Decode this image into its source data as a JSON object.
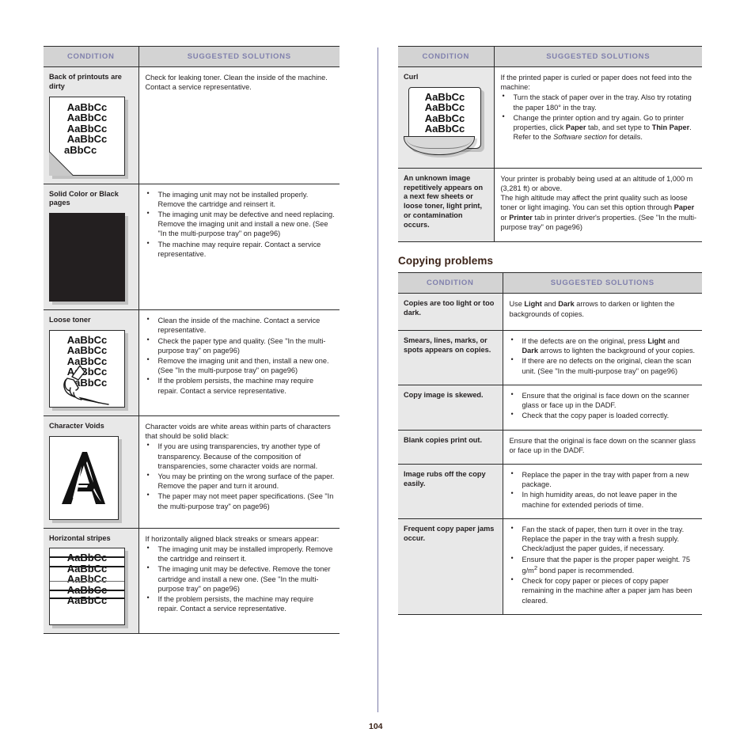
{
  "page": {
    "number": "104",
    "accent_header_bg": "#d3d3d3",
    "accent_header_text": "#8080ad",
    "rule_color": "#7b7ba8",
    "heading_color": "#3b2318"
  },
  "columns": {
    "left": {
      "table": {
        "headers": [
          "CONDITION",
          "SUGGESTED SOLUTIONS"
        ],
        "rows": [
          {
            "condition": "Back of printouts are dirty",
            "sample": "dirty-page-sample",
            "sample_lines": [
              "AaBbCc",
              "AaBbCc",
              "AaBbCc",
              "AaBbCc",
              "aBbCc"
            ],
            "lead": "Check for leaking toner. Clean the inside of the machine. Contact a service representative.",
            "bullets": []
          },
          {
            "condition": "Solid Color or Black pages",
            "sample": "solid-black-page-sample",
            "sample_lines": [],
            "lead": "",
            "bullets": [
              "The imaging unit may not be installed properly. Remove the cartridge and reinsert it.",
              "The imaging unit may be defective and need replacing. Remove the imaging unit and install a new one. (See \"In the multi-purpose tray\" on page96)",
              "The machine may require repair. Contact a service representative."
            ]
          },
          {
            "condition": "Loose toner",
            "sample": "loose-toner-page-sample",
            "sample_lines": [
              "AaBbCc",
              "AaBbCc",
              "AaBbCc",
              "AaBbCc",
              "AaBbCc"
            ],
            "lead": "",
            "bullets": [
              "Clean the inside of the machine. Contact a service representative.",
              "Check the paper type and quality. (See \"In the multi-purpose tray\" on page96)",
              "Remove the imaging unit and then, install a new one. (See \"In the multi-purpose tray\" on page96)",
              "If the problem persists, the machine may require repair. Contact a service representative."
            ]
          },
          {
            "condition": "Character Voids",
            "sample": "character-voids-page-sample",
            "sample_lines": [
              "A"
            ],
            "lead": "Character voids are white areas within parts of characters that should be solid black:",
            "bullets": [
              "If you are using transparencies, try another type of transparency. Because of the composition of transparencies, some character voids are normal.",
              "You may be printing on the wrong surface of the paper. Remove the paper and turn it around.",
              "The paper may not meet paper specifications. (See \"In the multi-purpose tray\" on page96)"
            ]
          },
          {
            "condition": "Horizontal stripes",
            "sample": "horizontal-stripes-page-sample",
            "sample_lines": [
              "AaBbCc",
              "AaBbCc",
              "AaBbCc",
              "AaBbCc",
              "AaBbCc"
            ],
            "lead": "If horizontally aligned black streaks or smears appear:",
            "bullets": [
              "The imaging unit may be installed improperly. Remove the cartridge and reinsert it.",
              "The imaging unit may be defective. Remove the toner cartridge and install a new one. (See \"In the multi-purpose tray\" on page96)",
              "If the problem persists, the machine may require repair. Contact a service representative."
            ]
          }
        ]
      }
    },
    "right": {
      "table_top": {
        "headers": [
          "CONDITION",
          "SUGGESTED SOLUTIONS"
        ],
        "rows": [
          {
            "condition": "Curl",
            "sample": "curled-page-sample",
            "sample_lines": [
              "AaBbCc",
              "AaBbCc",
              "AaBbCc",
              "AaBbCc"
            ],
            "lead": "If the printed paper is curled or paper does not feed into the machine:",
            "bullets_rich": [
              [
                {
                  "t": "Turn the stack of paper over in the tray. Also try rotating the paper 180",
                  "s": "n"
                },
                {
                  "t": "°",
                  "s": "n"
                },
                {
                  "t": " in the tray.",
                  "s": "n"
                }
              ],
              [
                {
                  "t": "Change the printer option and try again. Go to printer properties, click ",
                  "s": "n"
                },
                {
                  "t": "Paper",
                  "s": "b"
                },
                {
                  "t": " tab, and set type to ",
                  "s": "n"
                },
                {
                  "t": "Thin Paper",
                  "s": "b"
                },
                {
                  "t": ". Refer to the ",
                  "s": "n"
                },
                {
                  "t": "Software section",
                  "s": "i"
                },
                {
                  "t": " for details.",
                  "s": "n"
                }
              ]
            ]
          },
          {
            "condition": "An unknown image repetitively appears on a next few sheets or loose toner, light print, or contamination occurs.",
            "sample": "",
            "sample_lines": [],
            "paras_rich": [
              [
                {
                  "t": "Your printer is probably being used at an altitude of 1,000 m (3,281 ft) or above.",
                  "s": "n"
                }
              ],
              [
                {
                  "t": "The high altitude may affect the print quality such as loose toner or light imaging. You can set this option through ",
                  "s": "n"
                },
                {
                  "t": "Paper",
                  "s": "b"
                },
                {
                  "t": " or ",
                  "s": "n"
                },
                {
                  "t": "Printer",
                  "s": "b"
                },
                {
                  "t": " tab in printer driver's properties. (See \"In the multi-purpose tray\" on page96)",
                  "s": "n"
                }
              ]
            ]
          }
        ]
      },
      "section_heading": "Copying problems",
      "table_bottom": {
        "headers": [
          "CONDITION",
          "SUGGESTED SOLUTIONS"
        ],
        "rows": [
          {
            "condition": "Copies are too light or too dark.",
            "lead_rich": [
              {
                "t": "Use ",
                "s": "n"
              },
              {
                "t": "Light",
                "s": "b"
              },
              {
                "t": " and ",
                "s": "n"
              },
              {
                "t": "Dark",
                "s": "b"
              },
              {
                "t": " arrows to darken or lighten the backgrounds of copies.",
                "s": "n"
              }
            ],
            "bullets_rich": []
          },
          {
            "condition": "Smears, lines, marks, or spots appears on copies.",
            "lead_rich": [],
            "bullets_rich": [
              [
                {
                  "t": "If the defects are on the original, press ",
                  "s": "n"
                },
                {
                  "t": "Light",
                  "s": "b"
                },
                {
                  "t": " and ",
                  "s": "n"
                },
                {
                  "t": "Dark",
                  "s": "b"
                },
                {
                  "t": " arrows to lighten the background of your copies.",
                  "s": "n"
                }
              ],
              [
                {
                  "t": "If there are no defects on the original, clean the scan unit. (See \"In the multi-purpose tray\" on page96)",
                  "s": "n"
                }
              ]
            ]
          },
          {
            "condition": "Copy image is skewed.",
            "lead_rich": [],
            "bullets_rich": [
              [
                {
                  "t": "Ensure that the original is face down on the scanner glass or face up in the DADF.",
                  "s": "n"
                }
              ],
              [
                {
                  "t": "Check that the copy paper is loaded correctly.",
                  "s": "n"
                }
              ]
            ]
          },
          {
            "condition": "Blank copies print out.",
            "lead_rich": [
              {
                "t": "Ensure that the original is face down on the scanner glass or face up in the DADF.",
                "s": "n"
              }
            ],
            "bullets_rich": []
          },
          {
            "condition": "Image rubs off the copy easily.",
            "lead_rich": [],
            "bullets_rich": [
              [
                {
                  "t": "Replace the paper in the tray with paper from a new package.",
                  "s": "n"
                }
              ],
              [
                {
                  "t": "In high humidity areas, do not leave paper in the machine for extended periods of time.",
                  "s": "n"
                }
              ]
            ]
          },
          {
            "condition": "Frequent copy paper jams occur.",
            "lead_rich": [],
            "bullets_rich": [
              [
                {
                  "t": "Fan the stack of paper, then turn it over in the tray. Replace the paper in the tray with a fresh supply. Check/adjust the paper guides, if necessary.",
                  "s": "n"
                }
              ],
              [
                {
                  "t": "Ensure that the paper is the proper paper weight. 75 g/m",
                  "s": "n"
                },
                {
                  "t": "2",
                  "s": "sup"
                },
                {
                  "t": " bond paper is recommended.",
                  "s": "n"
                }
              ],
              [
                {
                  "t": "Check for copy paper or pieces of copy paper remaining in the machine after a paper jam has been cleared.",
                  "s": "n"
                }
              ]
            ]
          }
        ]
      }
    }
  }
}
